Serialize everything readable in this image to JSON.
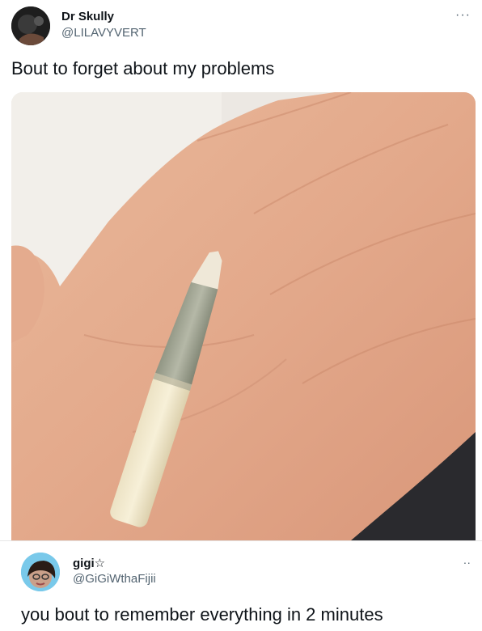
{
  "tweet": {
    "author_name": "Dr Skully",
    "author_handle": "@LILAVYVERT",
    "more": "···",
    "text": "Bout to forget about my problems",
    "avatar_icon": "user-avatar-dark",
    "image_alt_icon": "hand-holding-joint-photo"
  },
  "reply": {
    "author_name": "gigi☆",
    "author_handle": "@GiGiWthaFijii",
    "more": "··",
    "text": "you bout to remember everything in 2 minutes",
    "avatar_icon": "user-avatar-photo"
  }
}
